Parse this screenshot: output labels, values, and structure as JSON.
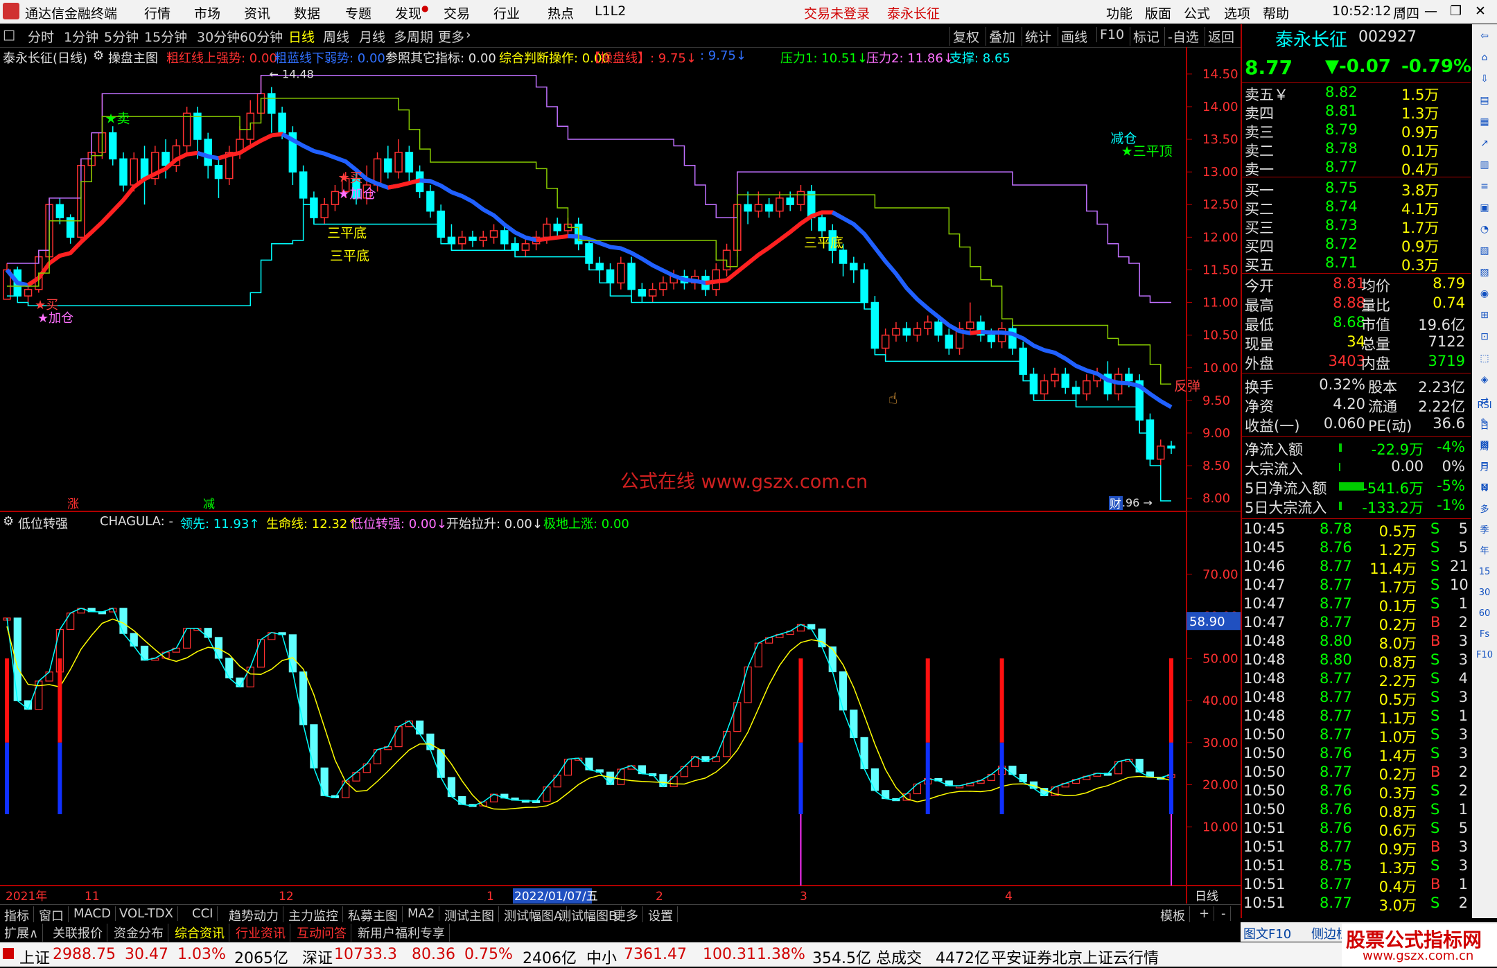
{
  "window": {
    "app_title": "通达信金融终端",
    "menu": [
      "行情",
      "市场",
      "资讯",
      "数据",
      "专题",
      "发现",
      "交易",
      "行业",
      "热点",
      "L1L2"
    ],
    "login_status": "交易未登录",
    "stock_title": "泰永长征",
    "right_menu": [
      "功能",
      "版面",
      "公式",
      "选项",
      "帮助"
    ],
    "clock": "10:52:12",
    "weekday": "周四"
  },
  "periods": {
    "items": [
      "分时",
      "1分钟",
      "5分钟",
      "15分钟",
      "30分钟",
      "60分钟",
      "日线",
      "周线",
      "月线",
      "多周期",
      "更多"
    ],
    "active": "日线",
    "tools": [
      "复权",
      "叠加",
      "统计",
      "画线",
      "F10",
      "标记",
      "-自选",
      "返回"
    ]
  },
  "main_chart": {
    "name": "泰永长征(日线)",
    "indicator": "操盘主图",
    "legend": [
      {
        "text": "粗红线上强势: 0.00",
        "color": "#ff3030"
      },
      {
        "text": "粗蓝线下弱势: 0.00",
        "color": "#3070ff"
      },
      {
        "text": "参照其它指标: 0.00",
        "color": "#e0e0e0"
      },
      {
        "text": "综合判断操作: 0.00",
        "color": "#ffff00"
      },
      {
        "text": "【操盘线】: 9.75↓",
        "color": "#ff3030"
      },
      {
        "text": ": 9.75↓",
        "color": "#3070ff"
      },
      {
        "text": "压力1: 10.51↓",
        "color": "#00ff00"
      },
      {
        "text": "压力2: 11.86↓",
        "color": "#ff70ff"
      },
      {
        "text": "支撑: 8.65",
        "color": "#00ffff"
      }
    ],
    "price_axis": [
      "14.50",
      "14.00",
      "13.50",
      "13.00",
      "12.50",
      "12.00",
      "11.50",
      "11.00",
      "10.50",
      "10.00",
      "9.50",
      "9.00",
      "8.50",
      "8.00"
    ],
    "high_label": "14.48",
    "low_label": "7.96",
    "watermark": "公式在线  www.gszx.com.cn",
    "annotations": [
      {
        "text": "★卖",
        "color": "#00ff00"
      },
      {
        "text": "★买",
        "color": "#ff4040"
      },
      {
        "text": "★加仓",
        "color": "#ff70ff"
      },
      {
        "text": "三平底",
        "color": "#ffff00"
      },
      {
        "text": "减仓",
        "color": "#00ffff"
      },
      {
        "text": "★三平顶",
        "color": "#00ff00"
      },
      {
        "text": "反弹",
        "color": "#ff4040"
      }
    ],
    "markers": [
      "涨",
      "减",
      "财"
    ]
  },
  "sub_chart": {
    "name": "低位转强",
    "legend": [
      {
        "text": "CHAGULA: -",
        "color": "#e0e0e0"
      },
      {
        "text": "领先: 11.93↑",
        "color": "#00ffff"
      },
      {
        "text": "生命线: 12.32↑",
        "color": "#ffff00"
      },
      {
        "text": "低位转强: 0.00↓",
        "color": "#ff70ff"
      },
      {
        "text": "开始拉升: 0.00↓",
        "color": "#e0e0e0"
      },
      {
        "text": "极地上涨: 0.00",
        "color": "#00ff00"
      }
    ],
    "value_axis": [
      "70.00",
      "60.00",
      "50.00",
      "40.00",
      "30.00",
      "20.00",
      "10.00"
    ],
    "current_value": "58.90"
  },
  "time_axis": {
    "labels": [
      "2021年",
      "11",
      "12",
      "1",
      "2022/01/07/五",
      "2",
      "3",
      "4"
    ],
    "period_label": "日线"
  },
  "tabs_row1": [
    "指标",
    "窗口",
    "MACD",
    "VOL-TDX",
    "CCI",
    "趋势动力",
    "主力监控",
    "私募主图",
    "MA2",
    "测试主图",
    "测试幅图A",
    "测试幅图B",
    "更多",
    "设置"
  ],
  "tabs_row1_right": [
    "模板",
    "+",
    "-"
  ],
  "tabs_row2": [
    "扩展∧",
    "关联报价",
    "资金分布",
    "综合资讯",
    "行业资讯",
    "互动问答",
    "新用户福利专享"
  ],
  "tabs_row2_right": [
    "图文F10",
    "侧边栏《",
    "笔",
    "价",
    "细",
    "势",
    "联",
    "值"
  ],
  "quote": {
    "name": "泰永长征",
    "code": "002927",
    "price": "8.77",
    "change": "▼-0.07",
    "pct": "-0.79%",
    "asks": [
      {
        "label": "卖五￥",
        "price": "8.82",
        "vol": "1.5万"
      },
      {
        "label": "卖四",
        "price": "8.81",
        "vol": "1.3万"
      },
      {
        "label": "卖三",
        "price": "8.79",
        "vol": "0.9万"
      },
      {
        "label": "卖二",
        "price": "8.78",
        "vol": "0.1万"
      },
      {
        "label": "卖一",
        "price": "8.77",
        "vol": "0.4万"
      }
    ],
    "bids": [
      {
        "label": "买一",
        "price": "8.75",
        "vol": "3.8万"
      },
      {
        "label": "买二",
        "price": "8.74",
        "vol": "4.1万"
      },
      {
        "label": "买三",
        "price": "8.73",
        "vol": "1.7万"
      },
      {
        "label": "买四",
        "price": "8.72",
        "vol": "0.9万"
      },
      {
        "label": "买五",
        "price": "8.71",
        "vol": "0.3万"
      }
    ],
    "stats": [
      {
        "l1": "今开",
        "v1": "8.81",
        "c1": "#ff3030",
        "l2": "均价",
        "v2": "8.79",
        "c2": "#ffff00"
      },
      {
        "l1": "最高",
        "v1": "8.88",
        "c1": "#ff3030",
        "l2": "量比",
        "v2": "0.74",
        "c2": "#ffff00"
      },
      {
        "l1": "最低",
        "v1": "8.68",
        "c1": "#00ff00",
        "l2": "市值",
        "v2": "19.6亿",
        "c2": "#e0e0e0"
      },
      {
        "l1": "现量",
        "v1": "34",
        "c1": "#ffff00",
        "l2": "总量",
        "v2": "7122",
        "c2": "#e0e0e0"
      },
      {
        "l1": "外盘",
        "v1": "3403",
        "c1": "#ff3030",
        "l2": "内盘",
        "v2": "3719",
        "c2": "#00ff00"
      }
    ],
    "fundamentals": [
      {
        "l1": "换手",
        "v1": "0.32%",
        "l2": "股本",
        "v2": "2.23亿"
      },
      {
        "l1": "净资",
        "v1": "4.20",
        "l2": "流通",
        "v2": "2.22亿"
      },
      {
        "l1": "收益(一)",
        "v1": "0.060",
        "l2": "PE(动)",
        "v2": "36.6"
      }
    ],
    "flows": [
      {
        "label": "净流入额",
        "value": "-22.9万",
        "pct": "-4%",
        "color": "#00ff00"
      },
      {
        "label": "大宗流入",
        "value": "0.00",
        "pct": "0%",
        "color": "#e0e0e0"
      },
      {
        "label": "5日净流入额",
        "value": "-541.6万",
        "pct": "-5%",
        "color": "#00ff00"
      },
      {
        "label": "5日大宗流入",
        "value": "-133.2万",
        "pct": "-1%",
        "color": "#00ff00"
      }
    ],
    "ticks": [
      {
        "t": "10:45",
        "p": "8.78",
        "v": "0.5万",
        "s": "S",
        "n": "5"
      },
      {
        "t": "10:45",
        "p": "8.76",
        "v": "1.2万",
        "s": "S",
        "n": "5"
      },
      {
        "t": "10:46",
        "p": "8.77",
        "v": "11.4万",
        "s": "S",
        "n": "21"
      },
      {
        "t": "10:47",
        "p": "8.77",
        "v": "1.7万",
        "s": "S",
        "n": "10"
      },
      {
        "t": "10:47",
        "p": "8.77",
        "v": "0.1万",
        "s": "S",
        "n": "1"
      },
      {
        "t": "10:47",
        "p": "8.77",
        "v": "0.2万",
        "s": "B",
        "n": "2"
      },
      {
        "t": "10:48",
        "p": "8.80",
        "v": "8.0万",
        "s": "B",
        "n": "3"
      },
      {
        "t": "10:48",
        "p": "8.80",
        "v": "0.8万",
        "s": "S",
        "n": "3"
      },
      {
        "t": "10:48",
        "p": "8.77",
        "v": "2.2万",
        "s": "S",
        "n": "4"
      },
      {
        "t": "10:48",
        "p": "8.77",
        "v": "0.5万",
        "s": "S",
        "n": "3"
      },
      {
        "t": "10:48",
        "p": "8.77",
        "v": "1.1万",
        "s": "S",
        "n": "1"
      },
      {
        "t": "10:50",
        "p": "8.77",
        "v": "1.0万",
        "s": "S",
        "n": "3"
      },
      {
        "t": "10:50",
        "p": "8.76",
        "v": "1.4万",
        "s": "S",
        "n": "3"
      },
      {
        "t": "10:50",
        "p": "8.77",
        "v": "0.2万",
        "s": "B",
        "n": "2"
      },
      {
        "t": "10:50",
        "p": "8.76",
        "v": "0.3万",
        "s": "S",
        "n": "2"
      },
      {
        "t": "10:50",
        "p": "8.76",
        "v": "0.8万",
        "s": "S",
        "n": "1"
      },
      {
        "t": "10:51",
        "p": "8.76",
        "v": "0.6万",
        "s": "S",
        "n": "5"
      },
      {
        "t": "10:51",
        "p": "8.77",
        "v": "0.9万",
        "s": "B",
        "n": "3"
      },
      {
        "t": "10:51",
        "p": "8.75",
        "v": "1.3万",
        "s": "S",
        "n": "3"
      },
      {
        "t": "10:51",
        "p": "8.77",
        "v": "0.4万",
        "s": "B",
        "n": "1"
      },
      {
        "t": "10:51",
        "p": "8.77",
        "v": "3.0万",
        "s": "S",
        "n": "2"
      }
    ]
  },
  "side_icons": [
    "RSI",
    "日",
    "周",
    "月",
    "N",
    "多",
    "季",
    "年",
    "15",
    "30",
    "60",
    "Fs",
    "F10"
  ],
  "statusbar": [
    {
      "text": "上证",
      "color": "#000"
    },
    {
      "text": "2988.75",
      "color": "#d00000"
    },
    {
      "text": "30.47",
      "color": "#d00000"
    },
    {
      "text": "1.03%",
      "color": "#d00000"
    },
    {
      "text": "2065亿",
      "color": "#000"
    },
    {
      "text": "深证",
      "color": "#000"
    },
    {
      "text": "10733.3",
      "color": "#d00000"
    },
    {
      "text": "80.36",
      "color": "#d00000"
    },
    {
      "text": "0.75%",
      "color": "#d00000"
    },
    {
      "text": "2406亿",
      "color": "#000"
    },
    {
      "text": "中小",
      "color": "#000"
    },
    {
      "text": "7361.47",
      "color": "#d00000"
    },
    {
      "text": "100.31",
      "color": "#d00000"
    },
    {
      "text": "1.38%",
      "color": "#d00000"
    },
    {
      "text": "354.5亿",
      "color": "#000"
    },
    {
      "text": "总成交",
      "color": "#000"
    },
    {
      "text": "4472亿",
      "color": "#000"
    },
    {
      "text": "平安证券北京上证云行情",
      "color": "#000"
    }
  ],
  "brand_watermark": "股票公式指标网",
  "brand_url": "www.gszx.com.cn",
  "chart_data": {
    "type": "candlestick",
    "price_ylim": [
      7.8,
      14.7
    ],
    "candles": [
      [
        11.05,
        11.5,
        11.1,
        11.6
      ],
      [
        11.5,
        11.1,
        11.0,
        11.55
      ],
      [
        11.1,
        11.2,
        10.95,
        11.3
      ],
      [
        11.2,
        11.7,
        11.15,
        11.8
      ],
      [
        11.7,
        12.5,
        11.65,
        12.6
      ],
      [
        12.5,
        12.3,
        12.2,
        12.6
      ],
      [
        12.3,
        12.0,
        11.9,
        12.35
      ],
      [
        12.0,
        13.1,
        11.95,
        13.2
      ],
      [
        13.1,
        13.3,
        12.9,
        13.6
      ],
      [
        13.3,
        13.6,
        13.2,
        14.2
      ],
      [
        13.6,
        13.2,
        13.1,
        13.7
      ],
      [
        13.2,
        12.8,
        12.7,
        13.3
      ],
      [
        12.8,
        13.2,
        12.7,
        13.3
      ],
      [
        13.2,
        12.9,
        12.5,
        13.4
      ],
      [
        12.9,
        13.3,
        12.8,
        13.4
      ],
      [
        13.3,
        13.1,
        12.9,
        13.5
      ],
      [
        13.1,
        13.4,
        13.0,
        13.5
      ],
      [
        13.4,
        13.9,
        13.3,
        14.0
      ],
      [
        13.9,
        13.5,
        13.2,
        14.0
      ],
      [
        13.5,
        13.1,
        12.9,
        13.6
      ],
      [
        13.1,
        12.9,
        12.6,
        13.2
      ],
      [
        12.9,
        13.3,
        12.8,
        13.4
      ],
      [
        13.3,
        13.5,
        13.2,
        13.7
      ],
      [
        13.5,
        13.9,
        13.4,
        14.1
      ],
      [
        13.9,
        14.2,
        13.8,
        14.48
      ],
      [
        14.2,
        13.9,
        13.6,
        14.3
      ],
      [
        13.9,
        13.6,
        13.5,
        14.0
      ],
      [
        13.6,
        13.0,
        12.8,
        13.7
      ],
      [
        13.0,
        12.6,
        12.5,
        13.1
      ],
      [
        12.6,
        12.3,
        12.2,
        12.7
      ],
      [
        12.3,
        12.5,
        12.2,
        12.6
      ],
      [
        12.5,
        12.7,
        12.4,
        12.8
      ],
      [
        12.7,
        12.9,
        12.6,
        13.0
      ],
      [
        12.9,
        12.6,
        12.5,
        13.0
      ],
      [
        12.6,
        12.8,
        12.5,
        13.1
      ],
      [
        12.8,
        13.2,
        12.7,
        13.3
      ],
      [
        13.2,
        13.0,
        12.9,
        13.4
      ],
      [
        13.0,
        13.3,
        12.9,
        13.5
      ],
      [
        13.3,
        13.0,
        12.8,
        13.4
      ],
      [
        13.0,
        12.7,
        12.6,
        13.1
      ],
      [
        12.7,
        12.4,
        12.3,
        12.8
      ],
      [
        12.4,
        12.0,
        11.9,
        12.5
      ],
      [
        12.0,
        11.9,
        11.8,
        12.2
      ],
      [
        11.9,
        12.0,
        11.8,
        12.1
      ],
      [
        12.0,
        11.95,
        11.85,
        12.1
      ],
      [
        11.95,
        12.0,
        11.85,
        12.1
      ],
      [
        12.0,
        12.1,
        11.9,
        12.2
      ],
      [
        12.1,
        11.9,
        11.8,
        12.2
      ],
      [
        11.9,
        11.8,
        11.7,
        12.0
      ],
      [
        11.8,
        11.9,
        11.7,
        12.0
      ],
      [
        11.9,
        12.0,
        11.8,
        12.1
      ],
      [
        12.0,
        12.2,
        11.9,
        12.3
      ],
      [
        12.2,
        12.1,
        12.0,
        12.3
      ],
      [
        12.1,
        12.2,
        12.0,
        12.3
      ],
      [
        12.2,
        11.9,
        11.8,
        12.3
      ],
      [
        11.9,
        11.6,
        11.5,
        12.0
      ],
      [
        11.6,
        11.5,
        11.3,
        11.7
      ],
      [
        11.5,
        11.3,
        11.1,
        11.6
      ],
      [
        11.3,
        11.6,
        11.2,
        11.7
      ],
      [
        11.6,
        11.2,
        11.0,
        11.7
      ],
      [
        11.2,
        11.1,
        11.0,
        11.3
      ],
      [
        11.1,
        11.2,
        11.0,
        11.3
      ],
      [
        11.2,
        11.3,
        11.1,
        11.4
      ],
      [
        11.3,
        11.4,
        11.2,
        11.5
      ],
      [
        11.4,
        11.3,
        11.2,
        11.5
      ],
      [
        11.3,
        11.4,
        11.2,
        11.5
      ],
      [
        11.4,
        11.2,
        11.1,
        11.5
      ],
      [
        11.2,
        11.5,
        11.1,
        11.6
      ],
      [
        11.5,
        11.8,
        11.4,
        11.9
      ],
      [
        11.8,
        12.5,
        11.7,
        13.0
      ],
      [
        12.5,
        12.4,
        12.2,
        12.7
      ],
      [
        12.4,
        12.5,
        12.3,
        12.7
      ],
      [
        12.5,
        12.4,
        12.3,
        12.6
      ],
      [
        12.4,
        12.6,
        12.3,
        12.7
      ],
      [
        12.6,
        12.5,
        12.4,
        12.7
      ],
      [
        12.5,
        12.7,
        12.4,
        12.8
      ],
      [
        12.7,
        12.3,
        12.1,
        12.8
      ],
      [
        12.3,
        12.1,
        12.0,
        12.4
      ],
      [
        12.1,
        11.8,
        11.6,
        12.2
      ],
      [
        11.8,
        11.6,
        11.4,
        11.9
      ],
      [
        11.6,
        11.5,
        11.3,
        11.7
      ],
      [
        11.5,
        11.0,
        10.9,
        11.6
      ],
      [
        11.0,
        10.3,
        10.2,
        11.1
      ],
      [
        10.3,
        10.5,
        10.1,
        10.6
      ],
      [
        10.5,
        10.6,
        10.4,
        10.7
      ],
      [
        10.6,
        10.5,
        10.4,
        10.7
      ],
      [
        10.5,
        10.6,
        10.4,
        10.7
      ],
      [
        10.6,
        10.7,
        10.5,
        10.8
      ],
      [
        10.7,
        10.5,
        10.4,
        10.8
      ],
      [
        10.5,
        10.3,
        10.2,
        10.6
      ],
      [
        10.3,
        10.6,
        10.2,
        10.7
      ],
      [
        10.6,
        10.7,
        10.5,
        11.0
      ],
      [
        10.7,
        10.5,
        10.4,
        10.8
      ],
      [
        10.5,
        10.4,
        10.3,
        10.6
      ],
      [
        10.4,
        10.6,
        10.3,
        10.7
      ],
      [
        10.6,
        10.3,
        10.2,
        10.7
      ],
      [
        10.3,
        9.9,
        9.8,
        10.4
      ],
      [
        9.9,
        9.6,
        9.5,
        10.0
      ],
      [
        9.6,
        9.8,
        9.5,
        9.9
      ],
      [
        9.8,
        9.9,
        9.7,
        10.0
      ],
      [
        9.9,
        9.7,
        9.6,
        10.0
      ],
      [
        9.7,
        9.6,
        9.4,
        9.8
      ],
      [
        9.6,
        9.8,
        9.5,
        9.9
      ],
      [
        9.8,
        9.9,
        9.7,
        10.0
      ],
      [
        9.9,
        9.6,
        9.5,
        10.1
      ],
      [
        9.6,
        9.9,
        9.5,
        10.0
      ],
      [
        9.9,
        9.8,
        9.7,
        10.0
      ],
      [
        9.8,
        9.2,
        9.0,
        9.9
      ],
      [
        9.2,
        8.6,
        8.5,
        9.3
      ],
      [
        8.6,
        8.8,
        7.96,
        8.9
      ],
      [
        8.8,
        8.77,
        8.68,
        8.88
      ]
    ]
  }
}
